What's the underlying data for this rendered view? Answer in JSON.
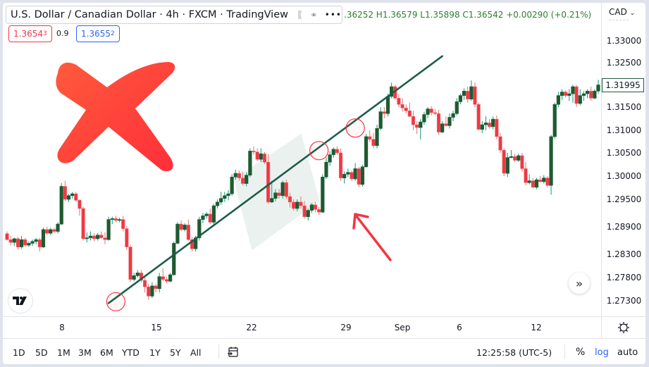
{
  "legend": {
    "title": "U.S. Dollar / Canadian Dollar · 4h · FXCM · TradingView",
    "ohlc_text": ".36252 H1.36579 L1.35898 C1.36542 +0.00290 (+0.21%)",
    "sell_price_main": "1.3654",
    "sell_price_sup": "3",
    "spread": "0.9",
    "buy_price_main": "1.3655",
    "buy_price_sup": "2",
    "more_label": "•••"
  },
  "price_scale": {
    "currency": "CAD",
    "last_price_tag": "1.31995"
  },
  "bottom_bar": {
    "ranges": [
      "1D",
      "5D",
      "1M",
      "3M",
      "6M",
      "YTD",
      "1Y",
      "5Y",
      "All"
    ],
    "clock": "12:25:58 (UTC-5)",
    "percent_label": "%",
    "log_label": "log",
    "auto_label": "auto"
  },
  "colors": {
    "up_body": "#1e5a30",
    "up_wick": "#089981",
    "down_body": "#f23645",
    "down_border": "#e57373",
    "trendline": "#1b5e4a",
    "annotation_red": "#f23645",
    "highlight_box": "#e8eeec"
  },
  "annotations": {
    "big_x_mark": "red cross (invalid pattern)",
    "arrow": "red arrow pointing at highlighted zone",
    "circles": 3
  },
  "chart_data": {
    "type": "candlestick",
    "title": "U.S. Dollar / Canadian Dollar · 4h · FXCM",
    "xlabel": "",
    "ylabel": "CAD",
    "x_ticks": [
      "8",
      "15",
      "22",
      "29",
      "Sep",
      "6",
      "12"
    ],
    "y_ticks": [
      "1.33000",
      "1.32500",
      "1.31500",
      "1.31000",
      "1.30500",
      "1.30000",
      "1.29500",
      "1.28900",
      "1.28300",
      "1.27800",
      "1.27300"
    ],
    "y_tick_values": [
      1.33,
      1.325,
      1.315,
      1.31,
      1.305,
      1.3,
      1.295,
      1.289,
      1.283,
      1.278,
      1.273
    ],
    "ylim": [
      1.2705,
      1.3345
    ],
    "last_price": 1.31995,
    "trendline": {
      "start": {
        "candle": 28,
        "price": 1.2725
      },
      "end": {
        "candle": 120,
        "price": 1.3265
      }
    },
    "highlight_zone": {
      "from_candle": 64,
      "to_candle": 85,
      "price_low": 1.2885,
      "price_high": 1.3085
    },
    "touch_circles": [
      {
        "candle": 30,
        "price": 1.2728
      },
      {
        "candle": 86,
        "price": 1.3055
      },
      {
        "candle": 96,
        "price": 1.3105
      }
    ],
    "candles": [
      [
        1.2875,
        1.288,
        1.286,
        1.2862
      ],
      [
        1.2862,
        1.287,
        1.285,
        1.2856
      ],
      [
        1.2856,
        1.2866,
        1.2848,
        1.2864
      ],
      [
        1.2864,
        1.2868,
        1.284,
        1.2846
      ],
      [
        1.2846,
        1.287,
        1.2842,
        1.2862
      ],
      [
        1.2862,
        1.2866,
        1.2846,
        1.285
      ],
      [
        1.285,
        1.2858,
        1.2846,
        1.2854
      ],
      [
        1.2854,
        1.2862,
        1.2848,
        1.2858
      ],
      [
        1.2858,
        1.2866,
        1.2852,
        1.2862
      ],
      [
        1.2862,
        1.2866,
        1.2836,
        1.2846
      ],
      [
        1.2846,
        1.2888,
        1.2844,
        1.2884
      ],
      [
        1.2884,
        1.289,
        1.2872,
        1.2876
      ],
      [
        1.2876,
        1.2888,
        1.2872,
        1.2884
      ],
      [
        1.2884,
        1.2888,
        1.2876,
        1.288
      ],
      [
        1.288,
        1.29,
        1.2876,
        1.2896
      ],
      [
        1.2896,
        1.2985,
        1.2894,
        1.2978
      ],
      [
        1.2978,
        1.299,
        1.2946,
        1.295
      ],
      [
        1.295,
        1.2962,
        1.2944,
        1.2958
      ],
      [
        1.2958,
        1.2966,
        1.2952,
        1.2962
      ],
      [
        1.2962,
        1.2966,
        1.2944,
        1.2948
      ],
      [
        1.2948,
        1.295,
        1.2914,
        1.293
      ],
      [
        1.293,
        1.2934,
        1.286,
        1.2864
      ],
      [
        1.2864,
        1.2878,
        1.2856,
        1.2866
      ],
      [
        1.2866,
        1.288,
        1.286,
        1.287
      ],
      [
        1.287,
        1.2876,
        1.2858,
        1.2864
      ],
      [
        1.2864,
        1.2876,
        1.286,
        1.2872
      ],
      [
        1.2872,
        1.288,
        1.2864,
        1.2866
      ],
      [
        1.2866,
        1.2878,
        1.2852,
        1.2862
      ],
      [
        1.2862,
        1.2912,
        1.286,
        1.2906
      ],
      [
        1.2906,
        1.2912,
        1.2896,
        1.2908
      ],
      [
        1.2908,
        1.2914,
        1.29,
        1.2904
      ],
      [
        1.2904,
        1.291,
        1.29,
        1.2906
      ],
      [
        1.2906,
        1.2914,
        1.288,
        1.2886
      ],
      [
        1.2886,
        1.2892,
        1.284,
        1.2846
      ],
      [
        1.2846,
        1.285,
        1.277,
        1.2776
      ],
      [
        1.2776,
        1.279,
        1.2772,
        1.2784
      ],
      [
        1.2784,
        1.2796,
        1.278,
        1.279
      ],
      [
        1.279,
        1.2796,
        1.277,
        1.2774
      ],
      [
        1.2774,
        1.2784,
        1.2748,
        1.276
      ],
      [
        1.276,
        1.2766,
        1.2732,
        1.274
      ],
      [
        1.274,
        1.277,
        1.2736,
        1.2762
      ],
      [
        1.2762,
        1.2766,
        1.2748,
        1.2756
      ],
      [
        1.2756,
        1.279,
        1.2748,
        1.2782
      ],
      [
        1.2782,
        1.28,
        1.2772,
        1.2776
      ],
      [
        1.2776,
        1.2782,
        1.2768,
        1.2772
      ],
      [
        1.2772,
        1.279,
        1.277,
        1.2786
      ],
      [
        1.2786,
        1.2858,
        1.2784,
        1.2854
      ],
      [
        1.2854,
        1.29,
        1.2852,
        1.2896
      ],
      [
        1.2896,
        1.2904,
        1.288,
        1.2884
      ],
      [
        1.2884,
        1.2898,
        1.288,
        1.2894
      ],
      [
        1.2894,
        1.2906,
        1.286,
        1.2862
      ],
      [
        1.2862,
        1.2868,
        1.2836,
        1.2842
      ],
      [
        1.2842,
        1.287,
        1.2836,
        1.2866
      ],
      [
        1.2866,
        1.2912,
        1.286,
        1.2906
      ],
      [
        1.2906,
        1.292,
        1.2898,
        1.2914
      ],
      [
        1.2914,
        1.2922,
        1.2908,
        1.2918
      ],
      [
        1.2918,
        1.293,
        1.2896,
        1.29
      ],
      [
        1.29,
        1.294,
        1.2896,
        1.2936
      ],
      [
        1.2936,
        1.295,
        1.293,
        1.2944
      ],
      [
        1.2944,
        1.2966,
        1.2938,
        1.2952
      ],
      [
        1.2952,
        1.2966,
        1.2944,
        1.2958
      ],
      [
        1.2958,
        1.297,
        1.2948,
        1.2962
      ],
      [
        1.2962,
        1.3004,
        1.2958,
        1.2998
      ],
      [
        1.2998,
        1.3014,
        1.2992,
        1.3006
      ],
      [
        1.3006,
        1.3012,
        1.299,
        1.2996
      ],
      [
        1.2996,
        1.301,
        1.298,
        1.2984
      ],
      [
        1.2984,
        1.3008,
        1.2978,
        1.3002
      ],
      [
        1.3002,
        1.306,
        1.2998,
        1.3054
      ],
      [
        1.3054,
        1.3064,
        1.3046,
        1.3052
      ],
      [
        1.3052,
        1.306,
        1.3032,
        1.3036
      ],
      [
        1.3036,
        1.306,
        1.303,
        1.3048
      ],
      [
        1.3048,
        1.3052,
        1.3026,
        1.303
      ],
      [
        1.303,
        1.3048,
        1.294,
        1.2944
      ],
      [
        1.2944,
        1.299,
        1.2942,
        1.2952
      ],
      [
        1.2952,
        1.2972,
        1.2946,
        1.2964
      ],
      [
        1.2964,
        1.2972,
        1.2952,
        1.2958
      ],
      [
        1.2958,
        1.299,
        1.2952,
        1.2986
      ],
      [
        1.2986,
        1.2992,
        1.295,
        1.2956
      ],
      [
        1.2956,
        1.2964,
        1.2932,
        1.2944
      ],
      [
        1.2944,
        1.295,
        1.2926,
        1.293
      ],
      [
        1.293,
        1.295,
        1.2924,
        1.2944
      ],
      [
        1.2944,
        1.2956,
        1.293,
        1.2936
      ],
      [
        1.2936,
        1.2946,
        1.2908,
        1.2912
      ],
      [
        1.2912,
        1.293,
        1.2904,
        1.2926
      ],
      [
        1.2926,
        1.2942,
        1.292,
        1.2938
      ],
      [
        1.2938,
        1.2944,
        1.2922,
        1.2928
      ],
      [
        1.2928,
        1.2934,
        1.2916,
        1.2922
      ],
      [
        1.2922,
        1.3004,
        1.292,
        1.2998
      ],
      [
        1.2998,
        1.304,
        1.2994,
        1.303
      ],
      [
        1.303,
        1.3054,
        1.3022,
        1.3046
      ],
      [
        1.3046,
        1.3062,
        1.304,
        1.3058
      ],
      [
        1.3058,
        1.3064,
        1.3046,
        1.305
      ],
      [
        1.305,
        1.306,
        1.299,
        1.2996
      ],
      [
        1.2996,
        1.301,
        1.2984,
        1.3004
      ],
      [
        1.3004,
        1.3016,
        1.2998,
        1.3008
      ],
      [
        1.3008,
        1.3012,
        1.299,
        1.2994
      ],
      [
        1.2994,
        1.3028,
        1.299,
        1.3016
      ],
      [
        1.3016,
        1.302,
        1.2976,
        1.2982
      ],
      [
        1.2982,
        1.3024,
        1.2978,
        1.302
      ],
      [
        1.302,
        1.3092,
        1.3018,
        1.3086
      ],
      [
        1.3086,
        1.31,
        1.3074,
        1.308
      ],
      [
        1.308,
        1.3094,
        1.306,
        1.3066
      ],
      [
        1.3066,
        1.3112,
        1.306,
        1.3104
      ],
      [
        1.3104,
        1.315,
        1.31,
        1.314
      ],
      [
        1.314,
        1.315,
        1.3126,
        1.3136
      ],
      [
        1.3136,
        1.318,
        1.313,
        1.3174
      ],
      [
        1.3174,
        1.3205,
        1.317,
        1.3196
      ],
      [
        1.3196,
        1.32,
        1.3166,
        1.317
      ],
      [
        1.317,
        1.318,
        1.315,
        1.3156
      ],
      [
        1.3156,
        1.317,
        1.314,
        1.3148
      ],
      [
        1.3148,
        1.3156,
        1.3136,
        1.3142
      ],
      [
        1.3142,
        1.316,
        1.3128,
        1.313
      ],
      [
        1.313,
        1.3142,
        1.31,
        1.3112
      ],
      [
        1.3112,
        1.312,
        1.3092,
        1.3106
      ],
      [
        1.3106,
        1.3124,
        1.308,
        1.3118
      ],
      [
        1.3118,
        1.314,
        1.3112,
        1.3134
      ],
      [
        1.3134,
        1.315,
        1.3126,
        1.3146
      ],
      [
        1.3146,
        1.3152,
        1.3132,
        1.3138
      ],
      [
        1.3138,
        1.3146,
        1.3132,
        1.3136
      ],
      [
        1.3136,
        1.3144,
        1.309,
        1.3096
      ],
      [
        1.3096,
        1.312,
        1.3094,
        1.3114
      ],
      [
        1.3114,
        1.313,
        1.3108,
        1.311
      ],
      [
        1.311,
        1.3136,
        1.3104,
        1.3128
      ],
      [
        1.3128,
        1.3142,
        1.312,
        1.3136
      ],
      [
        1.3136,
        1.317,
        1.3132,
        1.3162
      ],
      [
        1.3162,
        1.318,
        1.3156,
        1.3176
      ],
      [
        1.3176,
        1.3192,
        1.3166,
        1.3186
      ],
      [
        1.3186,
        1.3196,
        1.316,
        1.3168
      ],
      [
        1.3168,
        1.321,
        1.3164,
        1.3196
      ],
      [
        1.3196,
        1.3206,
        1.315,
        1.3156
      ],
      [
        1.3156,
        1.316,
        1.31,
        1.3102
      ],
      [
        1.3102,
        1.312,
        1.3094,
        1.3112
      ],
      [
        1.3112,
        1.313,
        1.31,
        1.3116
      ],
      [
        1.3116,
        1.3124,
        1.3104,
        1.3108
      ],
      [
        1.3108,
        1.313,
        1.3102,
        1.3124
      ],
      [
        1.3124,
        1.3132,
        1.308,
        1.3086
      ],
      [
        1.3086,
        1.3094,
        1.305,
        1.3056
      ],
      [
        1.3056,
        1.306,
        1.3,
        1.3006
      ],
      [
        1.3006,
        1.305,
        1.2998,
        1.304
      ],
      [
        1.304,
        1.3056,
        1.3038,
        1.3042
      ],
      [
        1.3042,
        1.3048,
        1.303,
        1.3034
      ],
      [
        1.3034,
        1.3048,
        1.303,
        1.3044
      ],
      [
        1.3044,
        1.305,
        1.301,
        1.3016
      ],
      [
        1.3016,
        1.303,
        1.298,
        1.2986
      ],
      [
        1.2986,
        1.3004,
        1.2982,
        1.299
      ],
      [
        1.299,
        1.2996,
        1.2974,
        1.2976
      ],
      [
        1.2976,
        1.2996,
        1.2972,
        1.2992
      ],
      [
        1.2992,
        1.3,
        1.2986,
        1.2988
      ],
      [
        1.2988,
        1.3002,
        1.2984,
        1.2996
      ],
      [
        1.2996,
        1.3,
        1.2976,
        1.298
      ],
      [
        1.298,
        1.309,
        1.296,
        1.3086
      ],
      [
        1.3086,
        1.316,
        1.3082,
        1.3156
      ],
      [
        1.3156,
        1.3184,
        1.315,
        1.3176
      ],
      [
        1.3176,
        1.319,
        1.3166,
        1.3184
      ],
      [
        1.3184,
        1.3188,
        1.3172,
        1.3176
      ],
      [
        1.3176,
        1.319,
        1.3164,
        1.318
      ],
      [
        1.318,
        1.32,
        1.316,
        1.3196
      ],
      [
        1.3196,
        1.32,
        1.315,
        1.3158
      ],
      [
        1.3158,
        1.319,
        1.3154,
        1.3176
      ],
      [
        1.3176,
        1.3186,
        1.3164,
        1.318
      ],
      [
        1.318,
        1.319,
        1.317,
        1.3186
      ],
      [
        1.3186,
        1.3196,
        1.3164,
        1.317
      ],
      [
        1.317,
        1.319,
        1.3168,
        1.3186
      ],
      [
        1.3186,
        1.3212,
        1.318,
        1.32
      ]
    ]
  }
}
